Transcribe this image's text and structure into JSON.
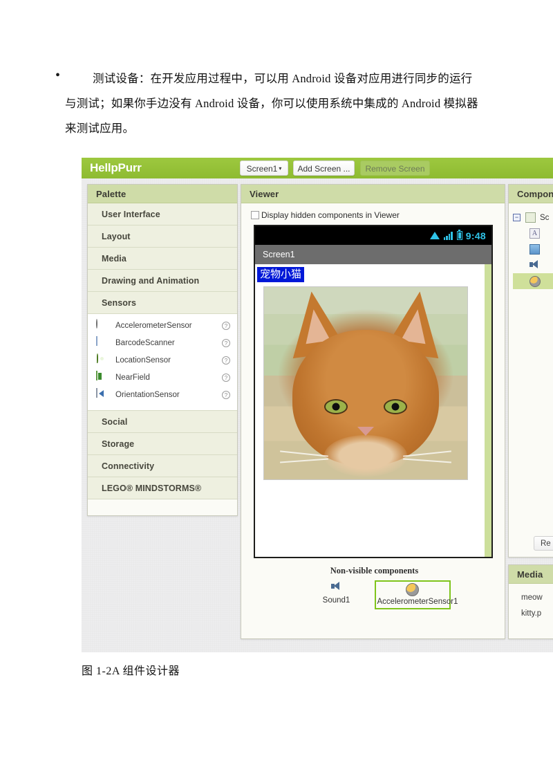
{
  "document": {
    "paragraph": "测试设备：在开发应用过程中，可以用 Android 设备对应用进行同步的运行与测试；如果你手边没有 Android 设备，你可以使用系统中集成的 Android 模拟器来测试应用。",
    "bullet_marker": "•",
    "figure_caption": "图 1-2A 组件设计器"
  },
  "app": {
    "title": "HellpPurr",
    "toolbar": {
      "screen_selector": "Screen1",
      "screen_selector_caret": "▾",
      "add_screen": "Add Screen ...",
      "remove_screen": "Remove Screen"
    },
    "colors": {
      "brand_green": "#8ebb31",
      "panel_header_green": "#cfdca8",
      "category_bg": "#eef0e0",
      "selection_green": "#cfe09a",
      "highlight_border": "#7fc41b",
      "label_blue": "#0018d8",
      "status_cyan": "#2fc3e8"
    }
  },
  "palette": {
    "header": "Palette",
    "categories": [
      {
        "label": "User Interface"
      },
      {
        "label": "Layout"
      },
      {
        "label": "Media"
      },
      {
        "label": "Drawing and Animation"
      },
      {
        "label": "Sensors"
      },
      {
        "label": "Social"
      },
      {
        "label": "Storage"
      },
      {
        "label": "Connectivity"
      },
      {
        "label": "LEGO® MINDSTORMS®"
      }
    ],
    "sensors": [
      {
        "name": "AccelerometerSensor",
        "icon": "accelerometer-icon",
        "help": "?"
      },
      {
        "name": "BarcodeScanner",
        "icon": "barcode-icon",
        "help": "?"
      },
      {
        "name": "LocationSensor",
        "icon": "location-pin-icon",
        "help": "?"
      },
      {
        "name": "NearField",
        "icon": "nearfield-icon",
        "help": "?"
      },
      {
        "name": "OrientationSensor",
        "icon": "orientation-icon",
        "help": "?"
      }
    ]
  },
  "viewer": {
    "header": "Viewer",
    "hidden_components_checkbox": "Display hidden components in Viewer",
    "phone": {
      "status_time": "9:48",
      "status_icons": [
        "wifi-icon",
        "signal-icon",
        "battery-icon"
      ],
      "title_bar": "Screen1",
      "label_text": "宠物小猫",
      "image_alt": "cat-photo"
    },
    "non_visible": {
      "title": "Non-visible components",
      "items": [
        {
          "name": "Sound1",
          "icon": "speaker-icon",
          "selected": false
        },
        {
          "name": "AccelerometerSensor1",
          "icon": "accelerometer-icon",
          "selected": true
        }
      ]
    }
  },
  "components": {
    "header": "Compone",
    "tree": [
      {
        "name": "Sc",
        "icon": "screen-icon",
        "expander": "−",
        "selected": false
      },
      {
        "name": "",
        "icon": "label-icon",
        "glyph": "A",
        "selected": false
      },
      {
        "name": "",
        "icon": "image-icon",
        "selected": false
      },
      {
        "name": "",
        "icon": "speaker-icon",
        "selected": false
      },
      {
        "name": "",
        "icon": "accelerometer-icon",
        "selected": true
      }
    ],
    "rename_button": "Re"
  },
  "media": {
    "header": "Media",
    "files": [
      "meow",
      "kitty.p"
    ]
  }
}
